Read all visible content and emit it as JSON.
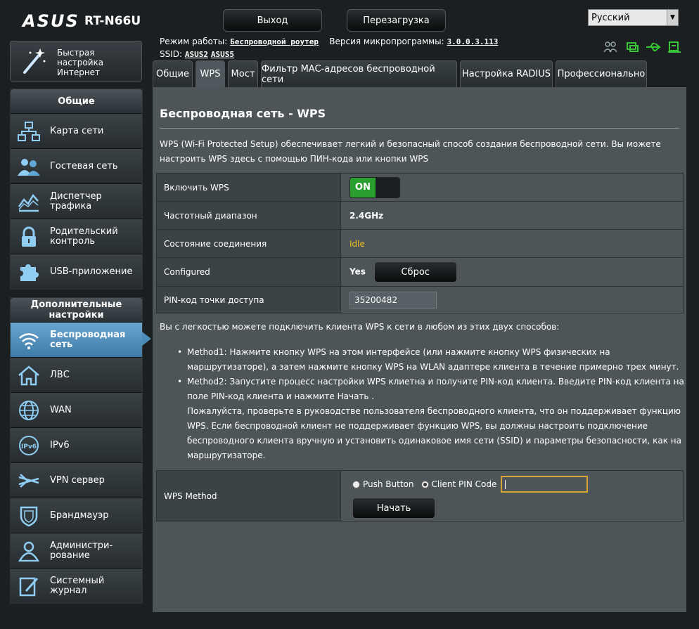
{
  "header": {
    "brand": "ASUS",
    "model": "RT-N66U",
    "logout_label": "Выход",
    "reboot_label": "Перезагрузка",
    "language": "Русский",
    "mode_label": "Режим работы:",
    "mode_value": "Беспроводной роутер",
    "firmware_label": "Версия микропрограммы:",
    "firmware_value": "3.0.0.3.113",
    "ssid_label": "SSID:",
    "ssid_values": [
      "ASUS2",
      "ASUS5"
    ]
  },
  "quick_setup": {
    "label": "Быстрая настройка Интернет"
  },
  "sidebar": {
    "general_title": "Общие",
    "general_items": [
      {
        "label": "Карта сети",
        "icon": "network-map-icon"
      },
      {
        "label": "Гостевая сеть",
        "icon": "guest-network-icon"
      },
      {
        "label": "Диспетчер трафика",
        "icon": "traffic-manager-icon"
      },
      {
        "label": "Родительский контроль",
        "icon": "lock-icon"
      },
      {
        "label": "USB-приложение",
        "icon": "puzzle-icon"
      }
    ],
    "advanced_title": "Дополнительные настройки",
    "advanced_items": [
      {
        "label": "Беспроводная сеть",
        "icon": "wifi-icon",
        "active": true
      },
      {
        "label": "ЛВС",
        "icon": "home-icon"
      },
      {
        "label": "WAN",
        "icon": "globe-icon"
      },
      {
        "label": "IPv6",
        "icon": "ipv6-icon"
      },
      {
        "label": "VPN сервер",
        "icon": "vpn-icon"
      },
      {
        "label": "Брандмауэр",
        "icon": "shield-icon"
      },
      {
        "label": "Администри-рование",
        "icon": "admin-icon"
      },
      {
        "label": "Системный журнал",
        "icon": "log-icon"
      }
    ]
  },
  "tabs": [
    "Общие",
    "WPS",
    "Мост",
    "Фильтр MAC-адресов беспроводной сети",
    "Настройка RADIUS",
    "Профессионально"
  ],
  "content": {
    "title": "Беспроводная сеть - WPS",
    "description": "WPS (Wi-Fi Protected Setup) обеспечивает легкий и безопасный способ создания беспроводной сети. Вы можете настроить WPS здесь с помощью ПИН-кода или кнопки WPS",
    "rows": {
      "enable_label": "Включить WPS",
      "enable_value": "ON",
      "band_label": "Частотный диапазон",
      "band_value": "2.4GHz",
      "state_label": "Состояние соединения",
      "state_value": "Idle",
      "configured_label": "Configured",
      "configured_value": "Yes",
      "reset_label": "Сброс",
      "pin_label": "PIN-код точки доступа",
      "pin_value": "35200482"
    },
    "intro": "Вы с легкостью можете подключить клиента WPS к сети в любом из этих двух способов:",
    "method1": "Method1: Нажмите кнопку WPS на этом интерфейсе (или нажмите кнопку WPS физических на маршрутизаторе), а затем нажмите кнопку WPS на WLAN адаптере клиента в течение примерно трех минут.",
    "method2": "Method2: Запустите процесс настройки WPS клиетна и получите PIN-код клиента. Введите PIN-код клиента на поле PIN-код клиента и нажмите Начать .",
    "method2_note": "Пожалуйста, проверьте в руководстве пользователя беспроводного клиента, что он поддерживает функцию WPS. Если беспроводной клиент не поддерживает функцию WPS, вы должны настроить подключение беспроводного клиента вручную и установить одинаковое имя сети (SSID) и параметры безопасности, как на маршрутизаторе.",
    "wps_method_label": "WPS Method",
    "push_button_label": "Push Button",
    "client_pin_label": "Client PIN Code",
    "client_pin_value": "",
    "start_label": "Начать"
  }
}
